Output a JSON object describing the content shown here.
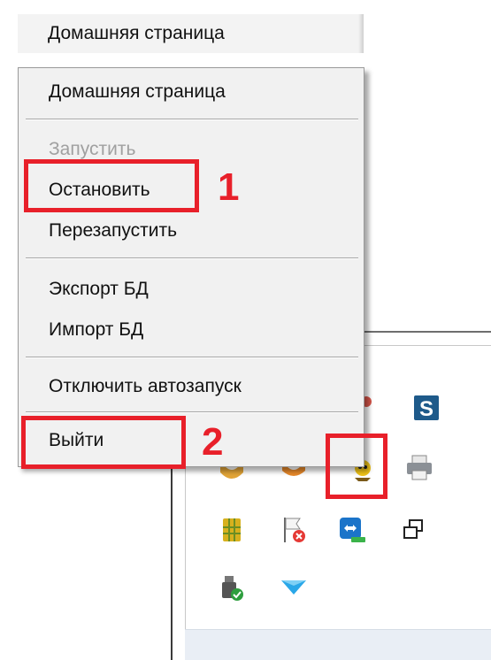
{
  "top_menu": {
    "item": "Домашняя страница"
  },
  "context_menu": {
    "items": [
      {
        "label": "Домашняя страница",
        "disabled": false
      },
      {
        "label": "Запустить",
        "disabled": true
      },
      {
        "label": "Остановить",
        "disabled": false
      },
      {
        "label": "Перезапустить",
        "disabled": false
      },
      {
        "label": "Экспорт БД",
        "disabled": false
      },
      {
        "label": "Импорт БД",
        "disabled": false
      },
      {
        "label": "Отключить автозапуск",
        "disabled": false
      },
      {
        "label": "Выйти",
        "disabled": false
      }
    ]
  },
  "annotations": {
    "step1": "1",
    "step2": "2"
  },
  "tray_icons": [
    "sandbox-s-icon",
    "printer-icon",
    "tray-app-icon",
    "sim-chip-icon",
    "flag-error-icon",
    "teamviewer-icon",
    "windows-copy-icon",
    "usb-safe-remove-icon",
    "arrow-down-icon"
  ],
  "colors": {
    "highlight": "#e8202a",
    "menu_bg": "#f1f1f1",
    "disabled_text": "#a0a0a0"
  }
}
